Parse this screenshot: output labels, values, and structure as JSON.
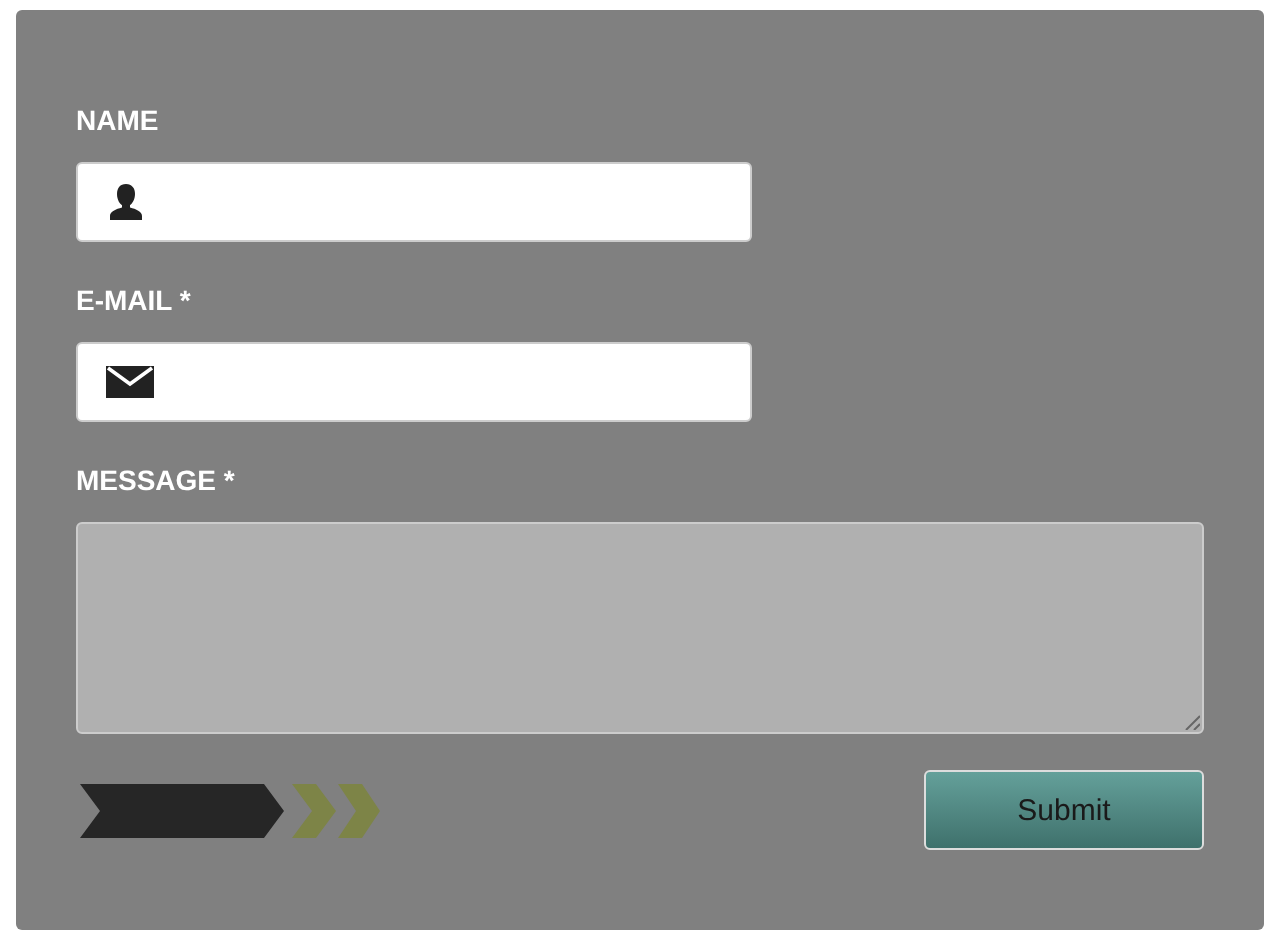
{
  "form": {
    "fields": [
      {
        "label": "NAME",
        "kind": "user"
      },
      {
        "label": "E-MAIL *",
        "kind": "email"
      },
      {
        "label": "MESSAGE *",
        "kind": "textarea"
      }
    ],
    "submit_button": "Submit"
  }
}
